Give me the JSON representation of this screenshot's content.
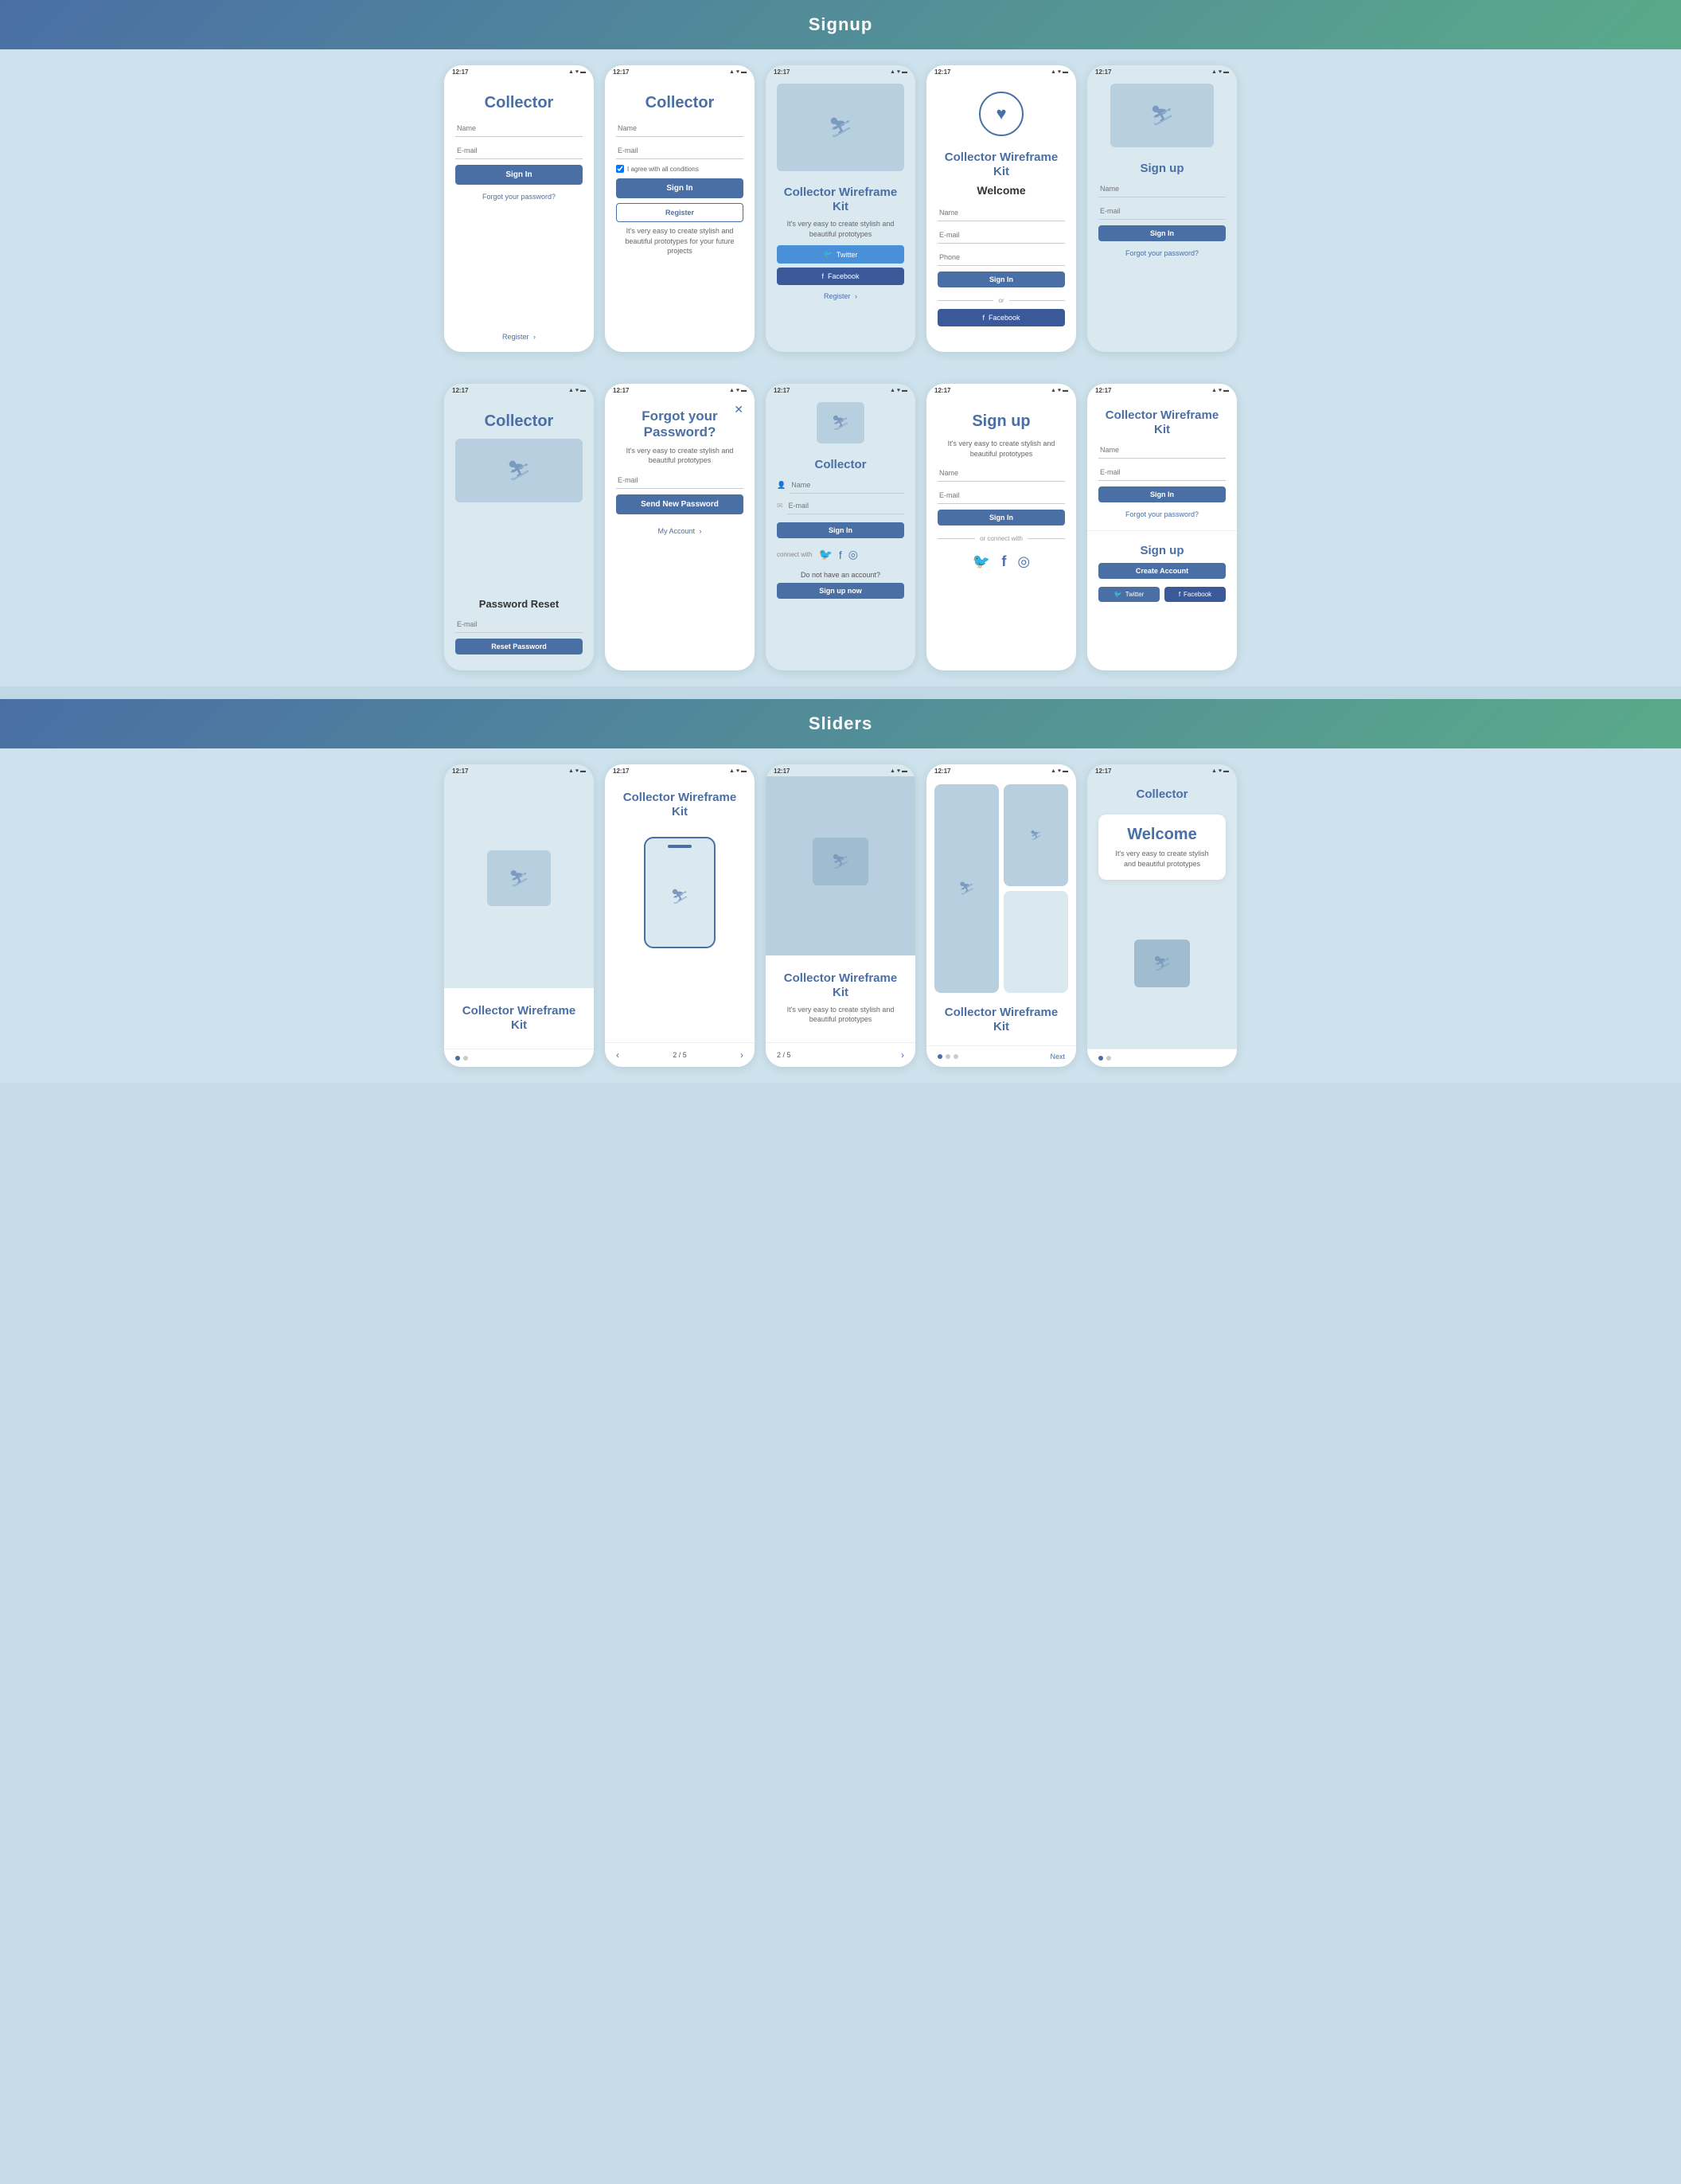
{
  "signup_section": {
    "title": "Signup",
    "phones": [
      {
        "id": "p1",
        "time": "12:17",
        "type": "simple-signin",
        "app_name": "Collector",
        "fields": [
          "Name",
          "E-mail"
        ],
        "primary_btn": "Sign In",
        "forgot_text": "Forgot your password?",
        "register_text": "Register",
        "show_register_arrow": true
      },
      {
        "id": "p2",
        "time": "12:17",
        "type": "register",
        "app_name": "Collector",
        "fields": [
          "Name",
          "E-mail"
        ],
        "checkbox_label": "I agree with all conditions",
        "primary_btn": "Sign In",
        "register_btn": "Register",
        "promo_text": "It's very easy to create stylish and beautiful prototypes for your future projects"
      },
      {
        "id": "p3",
        "time": "12:17",
        "type": "social-signin",
        "app_name": "Collector Wireframe Kit",
        "subtitle": "It's very easy to create stylish and beautiful prototypes",
        "twitter_btn": "Twitter",
        "facebook_btn": "Facebook",
        "register_text": "Register",
        "show_register_arrow": true
      },
      {
        "id": "p4",
        "time": "12:17",
        "type": "welcome",
        "app_name": "Collector Wireframe Kit",
        "welcome_text": "Welcome",
        "fields": [
          "Name",
          "E-mail",
          "Phone"
        ],
        "primary_btn": "Sign In",
        "or_text": "or",
        "facebook_btn": "Facebook"
      },
      {
        "id": "p5",
        "time": "12:17",
        "type": "simple-signup",
        "app_name": "Sign up",
        "fields": [
          "Name",
          "E-mail"
        ],
        "primary_btn": "Sign In",
        "forgot_text": "Forgot your password?"
      }
    ]
  },
  "signup_row2": {
    "phones": [
      {
        "id": "p6",
        "time": "12:17",
        "type": "password-reset",
        "app_name": "Collector",
        "reset_title": "Password Reset",
        "fields": [
          "E-mail"
        ],
        "primary_btn": "Reset Password"
      },
      {
        "id": "p7",
        "time": "12:17",
        "type": "forgot-password",
        "forgot_title": "Forgot your Password?",
        "subtitle": "It's very easy to create stylish and beautiful prototypes",
        "fields": [
          "E-mail"
        ],
        "primary_btn": "Send New Password",
        "my_account_text": "My Account"
      },
      {
        "id": "p8",
        "time": "12:17",
        "type": "connector-signin",
        "app_name": "Collector",
        "fields_icon": [
          "Name",
          "E-mail"
        ],
        "primary_btn": "Sign In",
        "connect_text": "connect with",
        "social_icons": [
          "twitter",
          "facebook",
          "instagram"
        ],
        "no_account_text": "Do not have an account?",
        "signup_now_btn": "Sign up now"
      },
      {
        "id": "p9",
        "time": "12:17",
        "type": "signup-social",
        "app_name": "Sign up",
        "subtitle": "It's very easy to create stylish and beautiful prototypes",
        "fields": [
          "Name",
          "E-mail"
        ],
        "primary_btn": "Sign In",
        "or_connect_text": "or connect with",
        "social_icons": [
          "twitter",
          "facebook",
          "instagram"
        ]
      },
      {
        "id": "p10",
        "time": "12:17",
        "type": "wireframe-signup",
        "app_name": "Collector Wireframe Kit",
        "fields_top": [
          "Name",
          "E-mail"
        ],
        "signin_btn": "Sign In",
        "forgot_text": "Forgot your password?",
        "signup_title": "Sign up",
        "create_btn": "Create Account",
        "twitter_btn": "Twitter",
        "facebook_btn": "Facebook"
      }
    ]
  },
  "sliders_section": {
    "title": "Sliders",
    "phones": [
      {
        "id": "s1",
        "time": "12:17",
        "type": "slider-bottom-card",
        "app_name": "Collector Wireframe Kit",
        "dots": [
          true,
          false
        ]
      },
      {
        "id": "s2",
        "time": "12:17",
        "type": "slider-nested-phone",
        "app_name": "Collector Wireframe Kit",
        "page": "2",
        "total": "5"
      },
      {
        "id": "s3",
        "time": "12:17",
        "type": "slider-top-img",
        "app_name": "Collector Wireframe Kit",
        "subtitle": "It's very easy to create stylish and beautiful prototypes",
        "page": "2",
        "total": "5"
      },
      {
        "id": "s4",
        "time": "12:17",
        "type": "slider-split",
        "app_name": "Collector Wireframe Kit",
        "next_text": "Next",
        "dots": [
          true,
          false,
          false
        ]
      },
      {
        "id": "s5",
        "time": "12:17",
        "type": "slider-card-overlay",
        "app_name": "Collector",
        "card_title": "Welcome",
        "card_subtitle": "It's very easy to create stylish and beautiful prototypes",
        "dots": [
          true,
          false
        ]
      }
    ]
  },
  "labels": {
    "register": "Register",
    "sign_in": "Sign In",
    "sign_up": "Sign up",
    "name": "Name",
    "email": "E-mail",
    "phone": "Phone",
    "forgot_password": "Forgot your password?",
    "twitter": "Twitter",
    "facebook": "Facebook",
    "or": "or",
    "connect_with": "connect with",
    "or_connect_with": "or connect with",
    "do_not_have_account": "Do not have an account?",
    "sign_up_now": "Sign up now",
    "send_new_password": "Send New Password",
    "reset_password": "Reset Password",
    "my_account": "My Account",
    "create_account": "Create Account",
    "next": "Next"
  }
}
